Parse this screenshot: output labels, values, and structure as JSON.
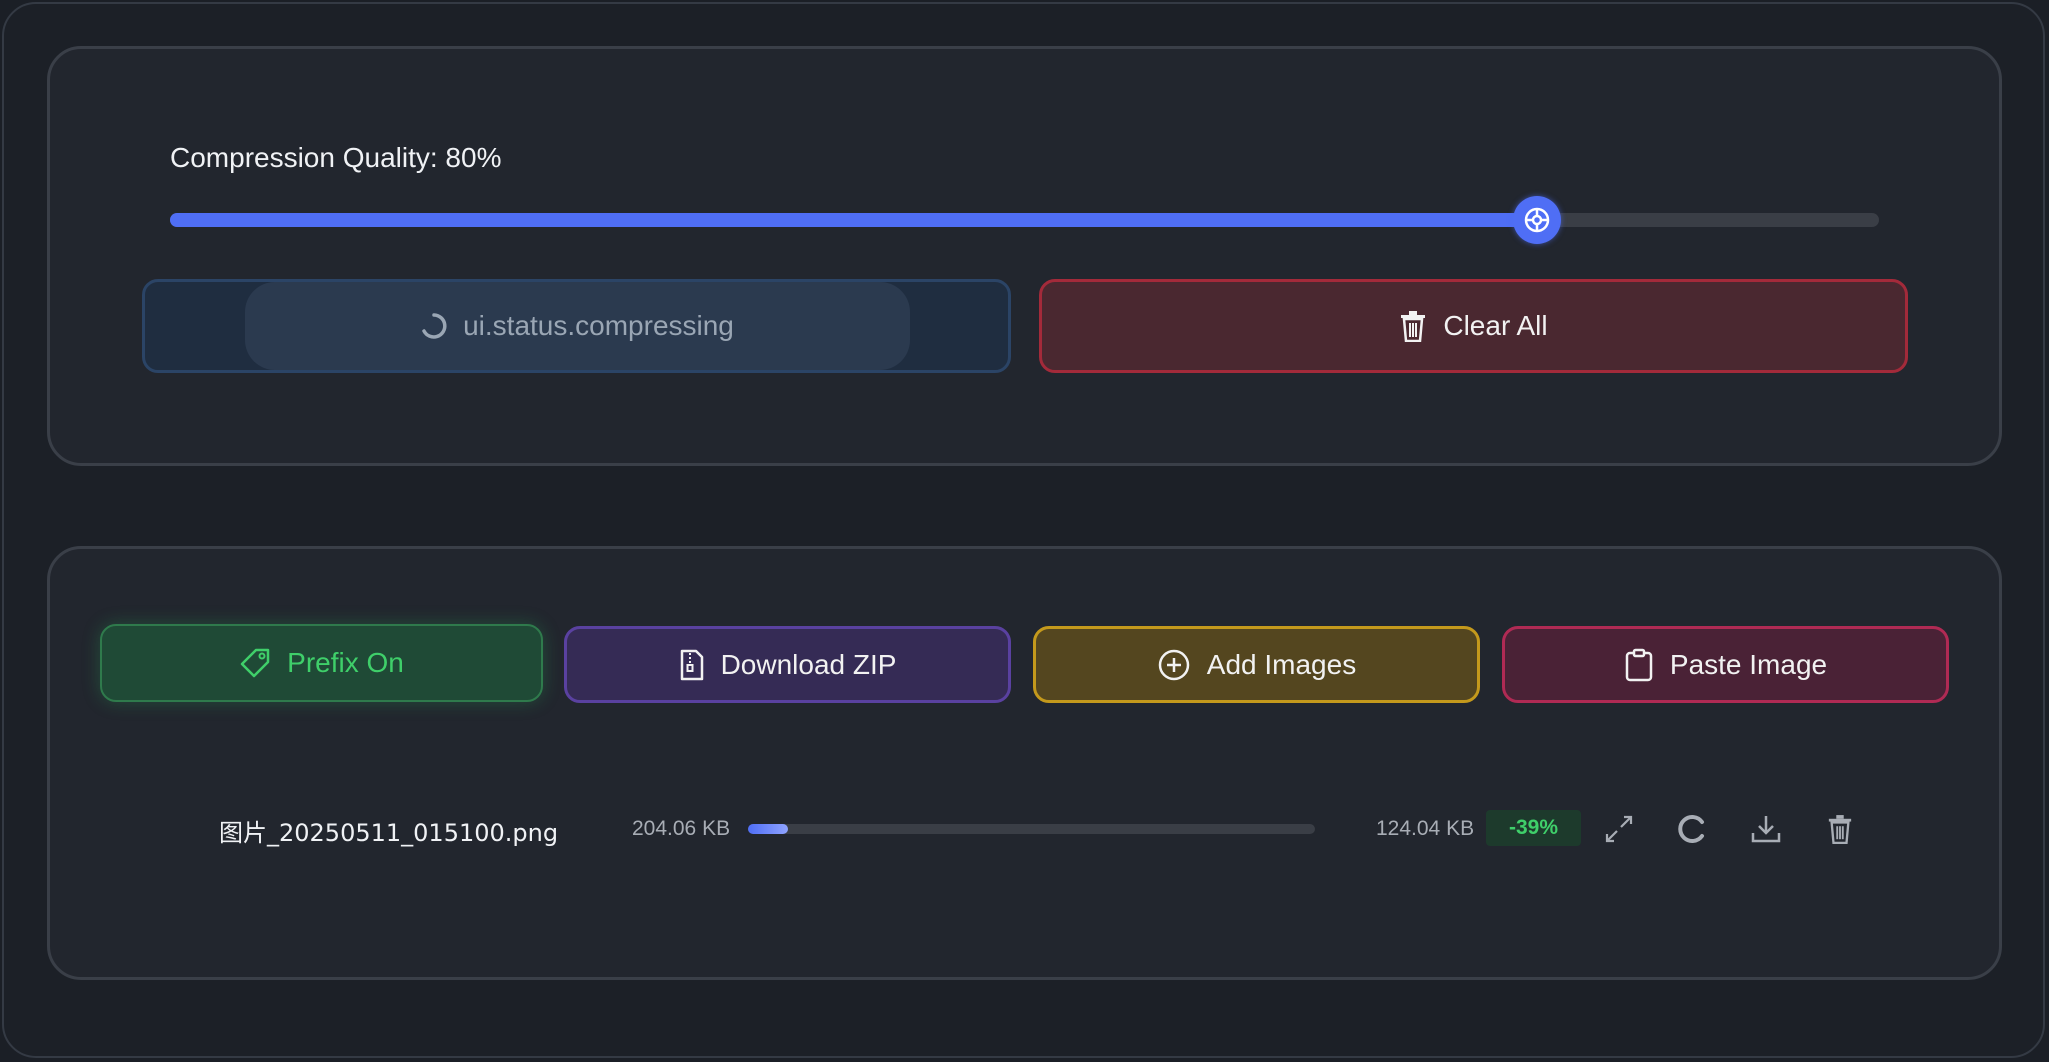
{
  "settings": {
    "quality_label": "Compression Quality: 80%",
    "quality_value_percent": 80
  },
  "actions": {
    "compress_label": "ui.status.compressing",
    "clear_label": "Clear All"
  },
  "toolbar": {
    "prefix_label": "Prefix On",
    "download_zip_label": "Download ZIP",
    "add_images_label": "Add Images",
    "paste_image_label": "Paste Image"
  },
  "files": [
    {
      "name": "图片_20250511_015100.png",
      "original_size": "204.06 KB",
      "progress_percent": 7,
      "compressed_size": "124.04 KB",
      "ratio": "-39%"
    }
  ],
  "colors": {
    "accent": "#4f6ef5",
    "success": "#3fcf6a",
    "danger": "#a32a3a",
    "warning": "#c4991c",
    "purple": "#5a41a0",
    "pink": "#b02a54"
  },
  "icons": {
    "slider_thumb": "settings-wheel-icon",
    "compress": "spinner-icon",
    "clear": "trash-icon",
    "prefix": "tag-icon",
    "zip": "file-zip-icon",
    "add": "plus-circle-icon",
    "paste": "clipboard-icon",
    "expand": "expand-icon",
    "retry": "refresh-icon",
    "download": "download-icon",
    "delete": "trash-icon"
  }
}
